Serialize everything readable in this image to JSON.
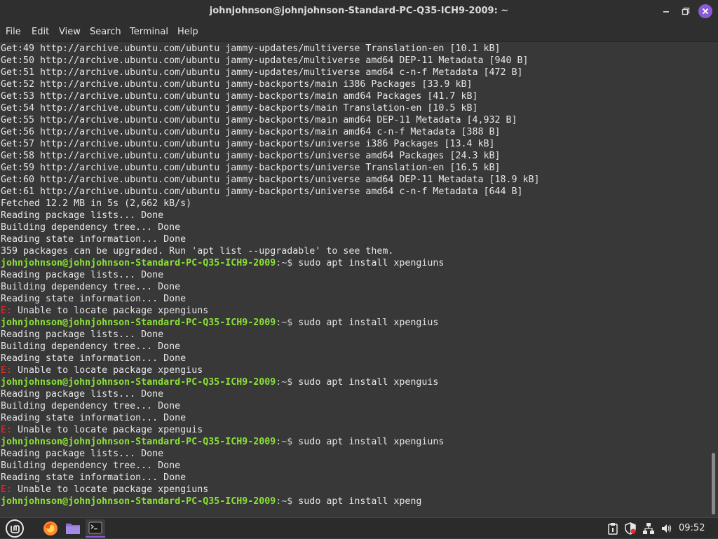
{
  "window": {
    "title": "johnjohnson@johnjohnson-Standard-PC-Q35-ICH9-2009: ~"
  },
  "menubar": {
    "items": [
      "File",
      "Edit",
      "View",
      "Search",
      "Terminal",
      "Help"
    ]
  },
  "terminal": {
    "prompt_user": "johnjohnson@johnjohnson-Standard-PC-Q35-ICH9-2009",
    "prompt_path": ":~$ ",
    "lines": [
      {
        "type": "out",
        "text": "Get:49 http://archive.ubuntu.com/ubuntu jammy-updates/multiverse Translation-en [10.1 kB]"
      },
      {
        "type": "out",
        "text": "Get:50 http://archive.ubuntu.com/ubuntu jammy-updates/multiverse amd64 DEP-11 Metadata [940 B]"
      },
      {
        "type": "out",
        "text": "Get:51 http://archive.ubuntu.com/ubuntu jammy-updates/multiverse amd64 c-n-f Metadata [472 B]"
      },
      {
        "type": "out",
        "text": "Get:52 http://archive.ubuntu.com/ubuntu jammy-backports/main i386 Packages [33.9 kB]"
      },
      {
        "type": "out",
        "text": "Get:53 http://archive.ubuntu.com/ubuntu jammy-backports/main amd64 Packages [41.7 kB]"
      },
      {
        "type": "out",
        "text": "Get:54 http://archive.ubuntu.com/ubuntu jammy-backports/main Translation-en [10.5 kB]"
      },
      {
        "type": "out",
        "text": "Get:55 http://archive.ubuntu.com/ubuntu jammy-backports/main amd64 DEP-11 Metadata [4,932 B]"
      },
      {
        "type": "out",
        "text": "Get:56 http://archive.ubuntu.com/ubuntu jammy-backports/main amd64 c-n-f Metadata [388 B]"
      },
      {
        "type": "out",
        "text": "Get:57 http://archive.ubuntu.com/ubuntu jammy-backports/universe i386 Packages [13.4 kB]"
      },
      {
        "type": "out",
        "text": "Get:58 http://archive.ubuntu.com/ubuntu jammy-backports/universe amd64 Packages [24.3 kB]"
      },
      {
        "type": "out",
        "text": "Get:59 http://archive.ubuntu.com/ubuntu jammy-backports/universe Translation-en [16.5 kB]"
      },
      {
        "type": "out",
        "text": "Get:60 http://archive.ubuntu.com/ubuntu jammy-backports/universe amd64 DEP-11 Metadata [18.9 kB]"
      },
      {
        "type": "out",
        "text": "Get:61 http://archive.ubuntu.com/ubuntu jammy-backports/universe amd64 c-n-f Metadata [644 B]"
      },
      {
        "type": "out",
        "text": "Fetched 12.2 MB in 5s (2,662 kB/s)"
      },
      {
        "type": "out",
        "text": "Reading package lists... Done"
      },
      {
        "type": "out",
        "text": "Building dependency tree... Done"
      },
      {
        "type": "out",
        "text": "Reading state information... Done"
      },
      {
        "type": "out",
        "text": "359 packages can be upgraded. Run 'apt list --upgradable' to see them."
      },
      {
        "type": "prompt",
        "text": "sudo apt install xpengiuns"
      },
      {
        "type": "out",
        "text": "Reading package lists... Done"
      },
      {
        "type": "out",
        "text": "Building dependency tree... Done"
      },
      {
        "type": "out",
        "text": "Reading state information... Done"
      },
      {
        "type": "err",
        "prefix": "E:",
        "text": " Unable to locate package xpengiuns"
      },
      {
        "type": "prompt",
        "text": "sudo apt install xpengius"
      },
      {
        "type": "out",
        "text": "Reading package lists... Done"
      },
      {
        "type": "out",
        "text": "Building dependency tree... Done"
      },
      {
        "type": "out",
        "text": "Reading state information... Done"
      },
      {
        "type": "err",
        "prefix": "E:",
        "text": " Unable to locate package xpengius"
      },
      {
        "type": "prompt",
        "text": "sudo apt install xpenguis"
      },
      {
        "type": "out",
        "text": "Reading package lists... Done"
      },
      {
        "type": "out",
        "text": "Building dependency tree... Done"
      },
      {
        "type": "out",
        "text": "Reading state information... Done"
      },
      {
        "type": "err",
        "prefix": "E:",
        "text": " Unable to locate package xpenguis"
      },
      {
        "type": "prompt",
        "text": "sudo apt install xpengiuns"
      },
      {
        "type": "out",
        "text": "Reading package lists... Done"
      },
      {
        "type": "out",
        "text": "Building dependency tree... Done"
      },
      {
        "type": "out",
        "text": "Reading state information... Done"
      },
      {
        "type": "err",
        "prefix": "E:",
        "text": " Unable to locate package xpengiuns"
      },
      {
        "type": "prompt",
        "text": "sudo apt install xpeng"
      }
    ]
  },
  "colors": {
    "prompt_user": "#8ae234",
    "error": "#ef2929",
    "background": "#383838",
    "accent": "#8a5bd6"
  },
  "taskbar": {
    "icons": [
      "mint-menu-icon",
      "firefox-icon",
      "files-icon",
      "terminal-icon"
    ],
    "tray": [
      "clipboard-icon",
      "shield-icon",
      "network-icon",
      "volume-icon"
    ],
    "clock": "09:52"
  }
}
